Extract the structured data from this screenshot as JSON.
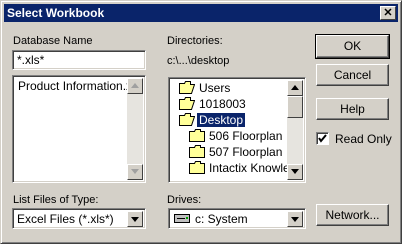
{
  "window": {
    "title": "Select Workbook",
    "close_glyph": "✕"
  },
  "database_name": {
    "label": "Database Name",
    "input_value": "*.xls*",
    "files": [
      "Product Information.xls"
    ]
  },
  "directories": {
    "label": "Directories:",
    "current_path": "c:\\...\\desktop",
    "items": [
      {
        "label": "Users",
        "icon": "open-folder-icon"
      },
      {
        "label": "1018003",
        "icon": "open-folder-icon"
      },
      {
        "label": "Desktop",
        "icon": "open-folder-icon",
        "selected": true
      },
      {
        "label": "506 Floorplan",
        "icon": "folder-icon"
      },
      {
        "label": "507 Floorplan",
        "icon": "folder-icon"
      },
      {
        "label": "Intactix Knowled",
        "icon": "folder-icon"
      }
    ]
  },
  "file_type": {
    "label": "List Files of Type:",
    "value": "Excel Files (*.xls*)"
  },
  "drives": {
    "label": "Drives:",
    "value": "c: System",
    "icon": "drive-icon"
  },
  "buttons": {
    "ok": "OK",
    "cancel": "Cancel",
    "help": "Help",
    "network": "Network..."
  },
  "read_only": {
    "label": "Read Only",
    "checked": true
  },
  "colors": {
    "face": "#d4d0c8",
    "titlebar": "#0a246a",
    "selection": "#0a246a",
    "folder": "#ffff99"
  }
}
